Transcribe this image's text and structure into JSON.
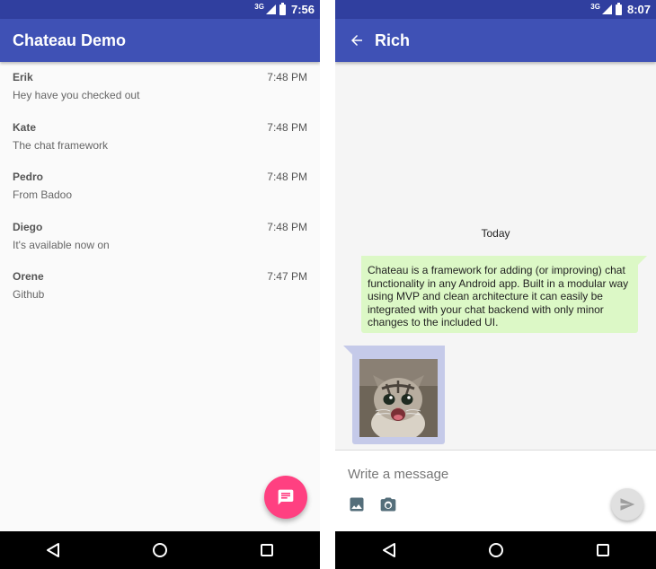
{
  "colors": {
    "status_bar": "#303f9f",
    "app_bar": "#3f51b5",
    "fab": "#ff4081",
    "outgoing_bubble": "#dcf8c6",
    "incoming_bubble": "#c5cae9"
  },
  "left_screen": {
    "status": {
      "network": "3G",
      "time": "7:56"
    },
    "app_bar": {
      "title": "Chateau Demo"
    },
    "conversations": [
      {
        "name": "Erik",
        "time": "7:48 PM",
        "message": "Hey have you checked out"
      },
      {
        "name": "Kate",
        "time": "7:48 PM",
        "message": "The chat framework"
      },
      {
        "name": "Pedro",
        "time": "7:48 PM",
        "message": "From Badoo"
      },
      {
        "name": "Diego",
        "time": "7:48 PM",
        "message": "It's available now on"
      },
      {
        "name": "Orene",
        "time": "7:47 PM",
        "message": "Github"
      }
    ],
    "fab_icon": "chat-icon"
  },
  "right_screen": {
    "status": {
      "network": "3G",
      "time": "8:07"
    },
    "app_bar": {
      "title": "Rich",
      "back_icon": "arrow-back-icon"
    },
    "date_header": "Today",
    "outgoing_message": "Chateau is a framework for adding (or improving) chat functionality in any Android app. Built in a modular way using MVP and clean architecture it can easily be integrated with your chat backend with only minor changes to the included UI.",
    "incoming_image": "kitten-photo",
    "composer": {
      "placeholder": "Write a message",
      "value": "",
      "icons": [
        "image-icon",
        "camera-icon",
        "send-icon"
      ]
    }
  },
  "navigation_bar": {
    "icons": [
      "back-triangle-icon",
      "home-circle-icon",
      "recents-square-icon"
    ]
  }
}
